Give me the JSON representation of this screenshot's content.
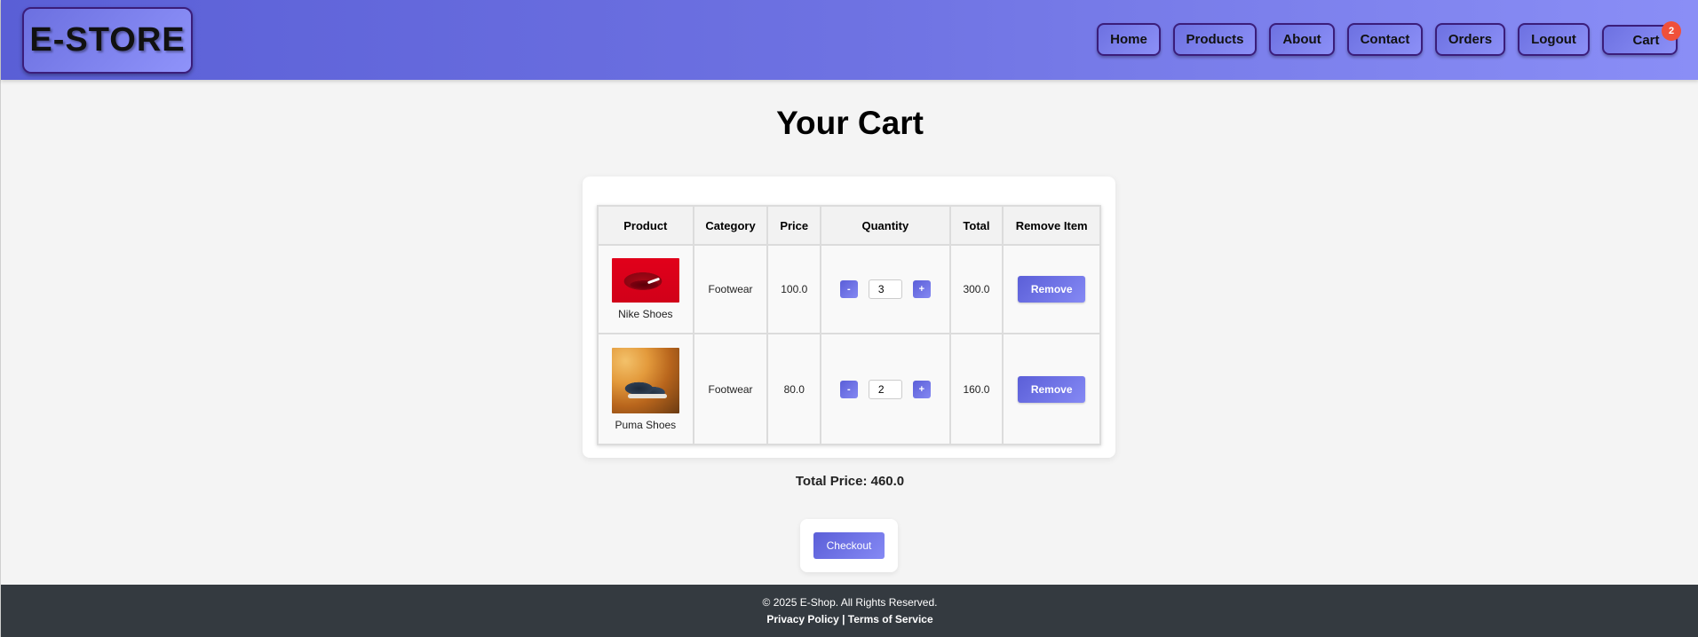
{
  "header": {
    "logo": "E-STORE",
    "nav": [
      {
        "label": "Home"
      },
      {
        "label": "Products"
      },
      {
        "label": "About"
      },
      {
        "label": "Contact"
      },
      {
        "label": "Orders"
      },
      {
        "label": "Logout"
      }
    ],
    "cart": {
      "label": "Cart",
      "badge": "2"
    }
  },
  "page": {
    "title": "Your Cart"
  },
  "cart_table": {
    "headers": [
      "Product",
      "Category",
      "Price",
      "Quantity",
      "Total",
      "Remove Item"
    ],
    "rows": [
      {
        "name": "Nike Shoes",
        "category": "Footwear",
        "price": "100.0",
        "quantity": "3",
        "total": "300.0",
        "remove_label": "Remove",
        "minus": "-",
        "plus": "+"
      },
      {
        "name": "Puma Shoes",
        "category": "Footwear",
        "price": "80.0",
        "quantity": "2",
        "total": "160.0",
        "remove_label": "Remove",
        "minus": "-",
        "plus": "+"
      }
    ]
  },
  "summary": {
    "total_price": "Total Price: 460.0"
  },
  "checkout": {
    "label": "Checkout"
  },
  "footer": {
    "copyright": "© 2025 E-Shop. All Rights Reserved.",
    "privacy": "Privacy Policy",
    "separator": " | ",
    "terms": "Terms of Service"
  },
  "colors": {
    "header_start": "#5a5fd6",
    "header_end": "#8a8ef6",
    "badge": "#f0503a",
    "footer": "#343a40",
    "button": "#5b5fd8"
  }
}
